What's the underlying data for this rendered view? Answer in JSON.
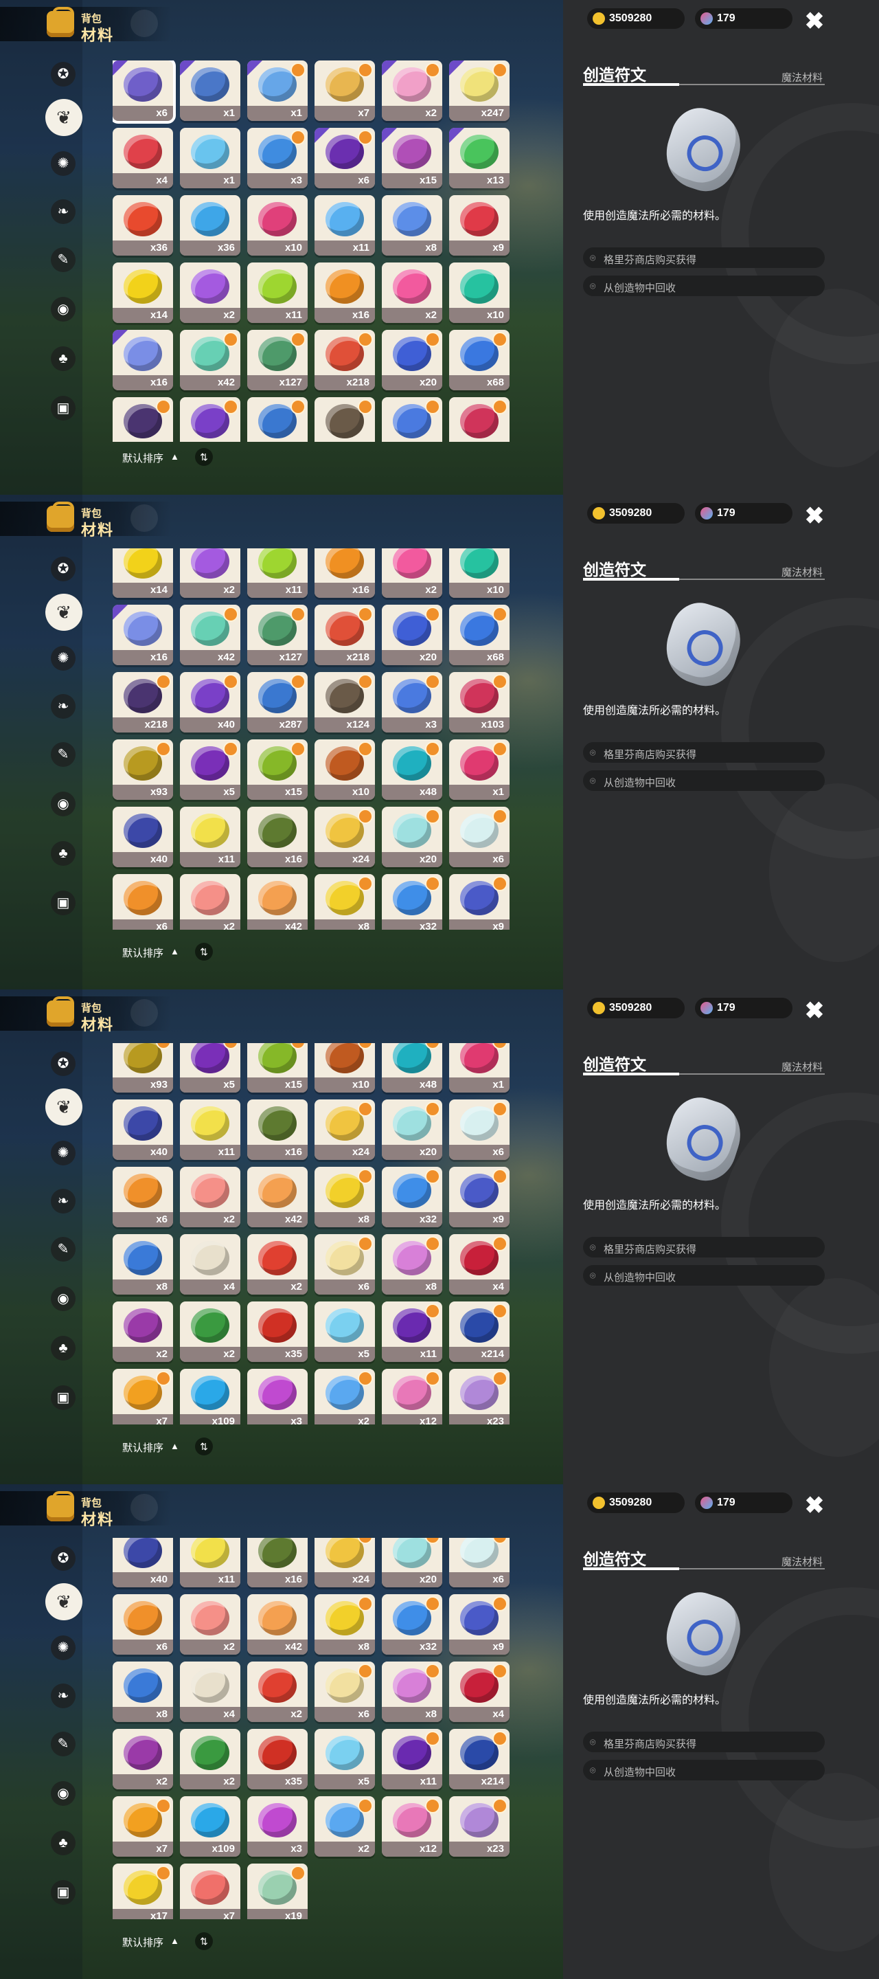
{
  "header": {
    "subtitle": "背包",
    "title": "材料"
  },
  "currency": {
    "coins": "3509280",
    "gems": "179"
  },
  "sidebar": {
    "tabs": [
      {
        "name": "star-tab",
        "glyph": "✪"
      },
      {
        "name": "materials-tab",
        "glyph": "❦",
        "active": true
      },
      {
        "name": "gear-tab",
        "glyph": "✺"
      },
      {
        "name": "leaf-tab",
        "glyph": "❧"
      },
      {
        "name": "scroll-tab",
        "glyph": "✎"
      },
      {
        "name": "orb-tab",
        "glyph": "◉"
      },
      {
        "name": "seed-tab",
        "glyph": "♣"
      },
      {
        "name": "chest-tab",
        "glyph": "▣"
      }
    ]
  },
  "sort": {
    "label": "默认排序",
    "arrow": "▲",
    "swap": "⇅"
  },
  "detail": {
    "title": "创造符文",
    "category": "魔法材料",
    "description": "使用创造魔法所必需的材料。",
    "sources": [
      "格里芬商店购买获得",
      "从创造物中回收"
    ],
    "close": "✖"
  },
  "inventory": [
    {
      "qty": "x6",
      "color": "#6f5fc9",
      "tier": true,
      "selected": true
    },
    {
      "qty": "x1",
      "color": "#4a77c8",
      "tier": true
    },
    {
      "qty": "x1",
      "color": "#66a6e8",
      "tier": true,
      "badge": true
    },
    {
      "qty": "x7",
      "color": "#e8b650",
      "badge": true
    },
    {
      "qty": "x2",
      "color": "#f1a0c8",
      "tier": true,
      "badge": true
    },
    {
      "qty": "x247",
      "color": "#f0e27a",
      "tier": true,
      "badge": true
    },
    {
      "qty": "x4",
      "color": "#e0414a"
    },
    {
      "qty": "x1",
      "color": "#69c4ee"
    },
    {
      "qty": "x3",
      "color": "#3f8ce0",
      "badge": true
    },
    {
      "qty": "x6",
      "color": "#6b2fb0",
      "tier": true,
      "badge": true
    },
    {
      "qty": "x15",
      "color": "#b04fb7",
      "tier": true
    },
    {
      "qty": "x13",
      "color": "#49c45c",
      "tier": true
    },
    {
      "qty": "x36",
      "color": "#e84a2e"
    },
    {
      "qty": "x36",
      "color": "#3ea6e8"
    },
    {
      "qty": "x10",
      "color": "#e0407a"
    },
    {
      "qty": "x11",
      "color": "#58b0f0"
    },
    {
      "qty": "x8",
      "color": "#5c8ee8"
    },
    {
      "qty": "x9",
      "color": "#e03a48"
    },
    {
      "qty": "x14",
      "color": "#f2d21a"
    },
    {
      "qty": "x2",
      "color": "#a45ae0"
    },
    {
      "qty": "x11",
      "color": "#9ed630"
    },
    {
      "qty": "x16",
      "color": "#f09022"
    },
    {
      "qty": "x2",
      "color": "#f25a9e"
    },
    {
      "qty": "x10",
      "color": "#26c2a0"
    },
    {
      "qty": "x16",
      "color": "#7a8ee6",
      "tier": true
    },
    {
      "qty": "x42",
      "color": "#67d0b4",
      "badge": true
    },
    {
      "qty": "x127",
      "color": "#4e9a6a",
      "badge": true
    },
    {
      "qty": "x218",
      "color": "#e05038",
      "badge": true
    },
    {
      "qty": "x20",
      "color": "#3f5fd6",
      "badge": true
    },
    {
      "qty": "x68",
      "color": "#3a78e0",
      "badge": true
    },
    {
      "qty": "x218",
      "color": "#4a3470",
      "badge": true
    },
    {
      "qty": "x40",
      "color": "#7a40c8",
      "badge": true
    },
    {
      "qty": "x287",
      "color": "#3a78d0",
      "badge": true
    },
    {
      "qty": "x124",
      "color": "#6a5a48",
      "badge": true
    },
    {
      "qty": "x3",
      "color": "#4a7ae0",
      "badge": true
    },
    {
      "qty": "x103",
      "color": "#d0345a",
      "badge": true
    },
    {
      "qty": "x93",
      "color": "#b89a20",
      "badge": true
    },
    {
      "qty": "x5",
      "color": "#7a2fb8",
      "badge": true
    },
    {
      "qty": "x15",
      "color": "#86b828",
      "badge": true
    },
    {
      "qty": "x10",
      "color": "#c05a20",
      "badge": true
    },
    {
      "qty": "x48",
      "color": "#1fb0c0",
      "badge": true
    },
    {
      "qty": "x1",
      "color": "#e03a70",
      "badge": true
    },
    {
      "qty": "x40",
      "color": "#3c48a8"
    },
    {
      "qty": "x11",
      "color": "#f2e04a"
    },
    {
      "qty": "x16",
      "color": "#5e7a30"
    },
    {
      "qty": "x24",
      "color": "#f0c440",
      "badge": true
    },
    {
      "qty": "x20",
      "color": "#9ee0e0",
      "badge": true
    },
    {
      "qty": "x6",
      "color": "#d8f0f0",
      "badge": true
    },
    {
      "qty": "x6",
      "color": "#f0902a"
    },
    {
      "qty": "x2",
      "color": "#f59088"
    },
    {
      "qty": "x42",
      "color": "#f4a050"
    },
    {
      "qty": "x8",
      "color": "#f2d02a",
      "badge": true
    },
    {
      "qty": "x32",
      "color": "#3f8ee8",
      "badge": true
    },
    {
      "qty": "x9",
      "color": "#4a5ac8",
      "badge": true
    },
    {
      "qty": "x8",
      "color": "#3a7ad8"
    },
    {
      "qty": "x4",
      "color": "#e8e0cc"
    },
    {
      "qty": "x2",
      "color": "#e04030"
    },
    {
      "qty": "x6",
      "color": "#f2e0a0",
      "badge": true
    },
    {
      "qty": "x8",
      "color": "#d880d8",
      "badge": true
    },
    {
      "qty": "x4",
      "color": "#c8203a",
      "badge": true
    },
    {
      "qty": "x2",
      "color": "#9a3aa8"
    },
    {
      "qty": "x2",
      "color": "#3a9a40"
    },
    {
      "qty": "x35",
      "color": "#d03024"
    },
    {
      "qty": "x5",
      "color": "#7ad0f0"
    },
    {
      "qty": "x11",
      "color": "#6a2ab0",
      "badge": true
    },
    {
      "qty": "x214",
      "color": "#2a4aa8",
      "badge": true
    },
    {
      "qty": "x7",
      "color": "#f2a020",
      "badge": true
    },
    {
      "qty": "x109",
      "color": "#2aa8e8"
    },
    {
      "qty": "x3",
      "color": "#c04ad0"
    },
    {
      "qty": "x2",
      "color": "#5aa8f0",
      "badge": true
    },
    {
      "qty": "x12",
      "color": "#e878b8",
      "badge": true
    },
    {
      "qty": "x23",
      "color": "#b088d8",
      "badge": true
    },
    {
      "qty": "x17",
      "color": "#f2d028",
      "badge": true
    },
    {
      "qty": "x7",
      "color": "#f0706a"
    },
    {
      "qty": "x19",
      "color": "#9ad0b0",
      "badge": true
    }
  ]
}
